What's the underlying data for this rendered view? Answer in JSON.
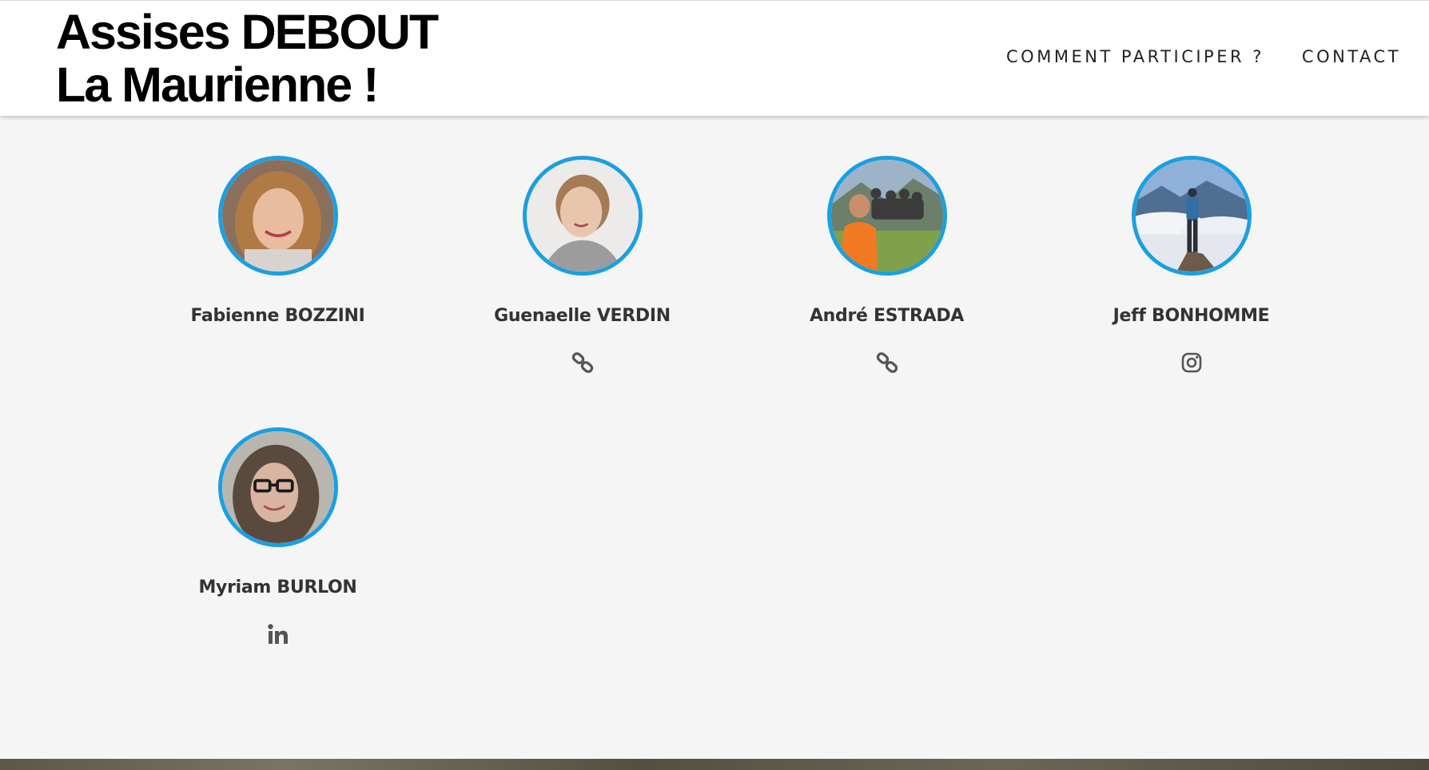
{
  "header": {
    "logo_line1": "Assises DEBOUT",
    "logo_line2": "La Maurienne !",
    "nav": [
      {
        "label": "COMMENT PARTICIPER ?"
      },
      {
        "label": "CONTACT"
      }
    ]
  },
  "accent_color": "#1a9fe3",
  "members": [
    {
      "name": "Fabienne BOZZINI",
      "social_icon": null
    },
    {
      "name": "Guenaelle VERDIN",
      "social_icon": "link-icon"
    },
    {
      "name": "André ESTRADA",
      "social_icon": "link-icon"
    },
    {
      "name": "Jeff BONHOMME",
      "social_icon": "instagram-icon"
    },
    {
      "name": "Myriam BURLON",
      "social_icon": "linkedin-icon"
    }
  ]
}
